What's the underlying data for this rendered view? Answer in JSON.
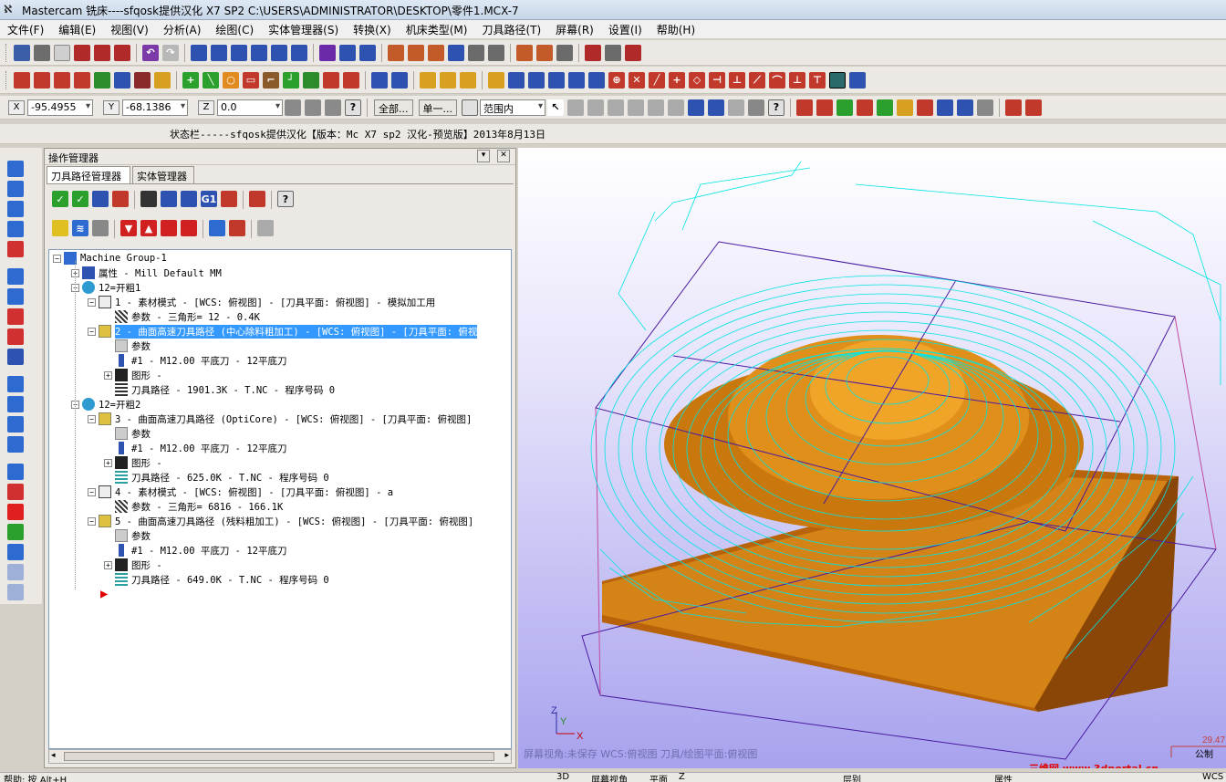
{
  "window": {
    "title": "Mastercam 铣床----sfqosk提供汉化 X7 SP2  C:\\USERS\\ADMINISTRATOR\\DESKTOP\\零件1.MCX-7"
  },
  "menu": [
    "文件(F)",
    "编辑(E)",
    "视图(V)",
    "分析(A)",
    "绘图(C)",
    "实体管理器(S)",
    "转换(X)",
    "机床类型(M)",
    "刀具路径(T)",
    "屏幕(R)",
    "设置(I)",
    "帮助(H)"
  ],
  "coords": {
    "x_label": "X",
    "x_value": "-95.4955",
    "y_label": "Y",
    "y_value": "-68.1386",
    "z_label": "Z",
    "z_value": "0.0",
    "all_button": "全部...",
    "single_button": "单一...",
    "range_select": "范围内"
  },
  "status_line": "状态栏-----sfqosk提供汉化【版本：Mc X7 sp2 汉化-预览版】2013年8月13日",
  "op_manager": {
    "header": "操作管理器",
    "tabs": [
      "刀具路径管理器",
      "实体管理器"
    ],
    "tree": [
      {
        "text": "Machine Group-1"
      },
      {
        "text": "属性 - Mill Default MM"
      },
      {
        "text": "12=开粗1"
      },
      {
        "text": "1 - 素材模式 - [WCS: 俯视图] - [刀具平面: 俯视图] - 模拟加工用"
      },
      {
        "text": "参数 - 三角形= 12 - 0.4K"
      },
      {
        "text": "2 - 曲面高速刀具路径 (中心除料粗加工) - [WCS: 俯视图] - [刀具平面: 俯视"
      },
      {
        "text": "参数"
      },
      {
        "text": "#1 - M12.00 平底刀 - 12平底刀"
      },
      {
        "text": "图形 -"
      },
      {
        "text": "刀具路径 - 1901.3K - T.NC - 程序号码 0"
      },
      {
        "text": "12=开粗2"
      },
      {
        "text": "3 - 曲面高速刀具路径 (OptiCore) - [WCS: 俯视图] - [刀具平面: 俯视图]"
      },
      {
        "text": "参数"
      },
      {
        "text": "#1 - M12.00 平底刀 - 12平底刀"
      },
      {
        "text": "图形 -"
      },
      {
        "text": "刀具路径 - 625.0K - T.NC - 程序号码 0"
      },
      {
        "text": "4 - 素材模式 - [WCS: 俯视图] - [刀具平面: 俯视图] - a"
      },
      {
        "text": "参数 - 三角形= 6816 - 166.1K"
      },
      {
        "text": "5 - 曲面高速刀具路径 (残料粗加工) - [WCS: 俯视图] - [刀具平面: 俯视图]"
      },
      {
        "text": "参数"
      },
      {
        "text": "#1 - M12.00 平底刀 - 12平底刀"
      },
      {
        "text": "图形 -"
      },
      {
        "text": "刀具路径 - 649.0K - T.NC - 程序号码 0"
      }
    ]
  },
  "viewport": {
    "status": "屏幕视角:未保存    WCS:俯视图    刀具/绘图平面:俯视图",
    "axis_x": "X",
    "axis_y": "Y",
    "axis_z": "Z",
    "scale_value": "29.47",
    "units": "公制",
    "watermark": "三维网 www.3dportal.cn"
  },
  "bottom": {
    "hint": "帮助: 按 Alt+H",
    "btn_3d": "3D",
    "btn_view": "屏幕视角",
    "btn_plane": "平面",
    "z_label": "Z",
    "layer_label": "层别",
    "attr_label": "属性",
    "wcs_label": "WCS"
  }
}
